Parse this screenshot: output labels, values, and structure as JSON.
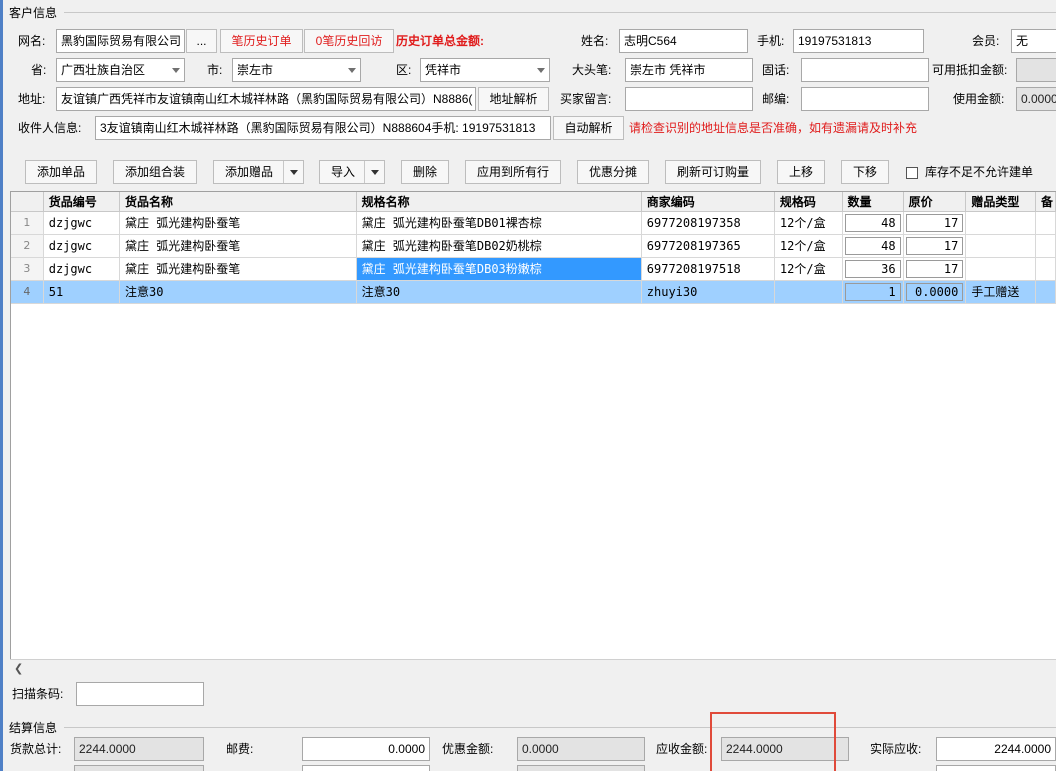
{
  "customer_section": {
    "title": "客户信息"
  },
  "customer": {
    "nickname_label": "网名:",
    "nickname_value": "黑豹国际贸易有限公司",
    "more_button": "...",
    "history_orders_button": "笔历史订单",
    "history_visits_button": "0笔历史回访",
    "history_total_label": "历史订单总金额:",
    "name_label": "姓名:",
    "name_value": "志明C564",
    "mobile_label": "手机:",
    "mobile_value": "19197531813",
    "member_label": "会员:",
    "member_value": "无",
    "province_label": "省:",
    "province_value": "广西壮族自治区",
    "city_label": "市:",
    "city_value": "崇左市",
    "district_label": "区:",
    "district_value": "凭祥市",
    "marker_label": "大头笔:",
    "marker_value": "崇左市 凭祥市",
    "phone_label": "固话:",
    "phone_value": "",
    "deduct_label": "可用抵扣金额:",
    "deduct_value": "",
    "address_label": "地址:",
    "address_value": "友谊镇广西凭祥市友谊镇南山红木城祥林路（黑豹国际贸易有限公司）N8886(",
    "address_parse_button": "地址解析",
    "buyer_msg_label": "买家留言:",
    "buyer_msg_value": "",
    "zip_label": "邮编:",
    "zip_value": "",
    "use_amount_label": "使用金额:",
    "use_amount_value": "0.0000",
    "receiver_label": "收件人信息:",
    "receiver_value": "3友谊镇南山红木城祥林路（黑豹国际贸易有限公司）N888604手机: 19197531813",
    "auto_parse_button": "自动解析",
    "warning_text": "请检查识别的地址信息是否准确，如有遗漏请及时补充"
  },
  "toolbar": {
    "add_item": "添加单品",
    "add_combo": "添加组合装",
    "add_gift": "添加赠品",
    "import": "导入",
    "delete": "删除",
    "apply_all": "应用到所有行",
    "discount_split": "优惠分摊",
    "refresh_qty": "刷新可订购量",
    "move_up": "上移",
    "move_down": "下移",
    "stock_check_label": "库存不足不允许建单"
  },
  "grid": {
    "columns": [
      "",
      "货品编号",
      "货品名称",
      "规格名称",
      "商家编码",
      "规格码",
      "数量",
      "原价",
      "赠品类型",
      "备"
    ],
    "rows": [
      {
        "rn": "1",
        "code": "dzjgwc",
        "name": "黛庄 弧光建构卧蚕笔",
        "spec": "黛庄 弧光建构卧蚕笔DB01裸杏棕",
        "merchant_code": "6977208197358",
        "spec_code": "12个/盒",
        "qty": "48",
        "price": "17",
        "gift_type": ""
      },
      {
        "rn": "2",
        "code": "dzjgwc",
        "name": "黛庄 弧光建构卧蚕笔",
        "spec": "黛庄 弧光建构卧蚕笔DB02奶桃棕",
        "merchant_code": "6977208197365",
        "spec_code": "12个/盒",
        "qty": "48",
        "price": "17",
        "gift_type": ""
      },
      {
        "rn": "3",
        "code": "dzjgwc",
        "name": "黛庄 弧光建构卧蚕笔",
        "spec": "黛庄 弧光建构卧蚕笔DB03粉嫩棕",
        "merchant_code": "6977208197518",
        "spec_code": "12个/盒",
        "qty": "36",
        "price": "17",
        "gift_type": ""
      },
      {
        "rn": "4",
        "code": "51",
        "name": "注意30",
        "spec": "注意30",
        "merchant_code": "zhuyi30",
        "spec_code": "",
        "qty": "1",
        "price": "0.0000",
        "gift_type": "手工赠送"
      }
    ]
  },
  "scan": {
    "label": "扫描条码:",
    "value": ""
  },
  "settlement_section": {
    "title": "结算信息"
  },
  "settlement": {
    "goods_total_label": "货款总计:",
    "goods_total_value": "2244.0000",
    "postage_label": "邮费:",
    "postage_value": "0.0000",
    "discount_label": "优惠金额:",
    "discount_value": "0.0000",
    "receivable_label": "应收金额:",
    "receivable_value": "2244.0000",
    "actual_label": "实际应收:",
    "actual_value": "2244.0000"
  },
  "colors": {
    "red": "#e01c1c",
    "selection": "#9fd0ff",
    "cell_selection": "#3399ff",
    "highlight_box": "#e04a3a"
  }
}
